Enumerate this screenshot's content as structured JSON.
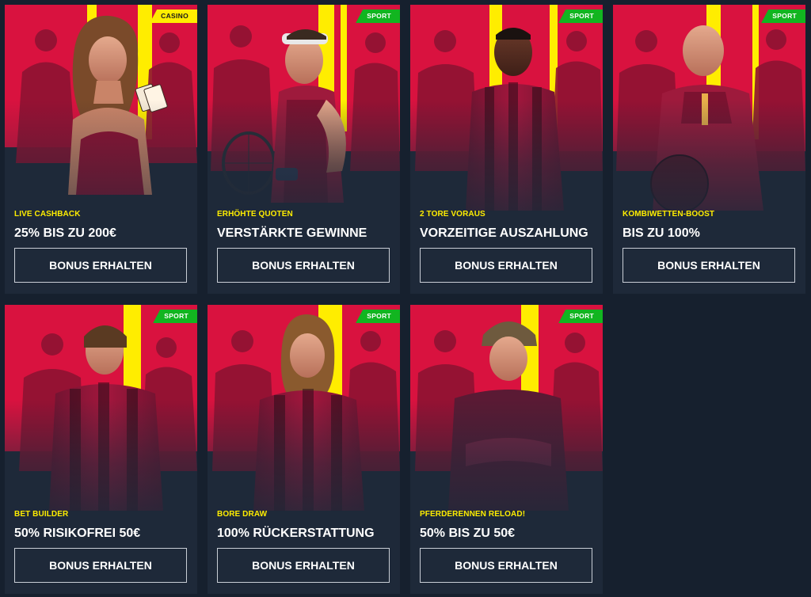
{
  "colors": {
    "page_background": "#16202e",
    "card_background": "#1e2939",
    "art_red": "#d9123f",
    "art_yellow": "#ffed00",
    "eyebrow_yellow": "#ffed00",
    "casino_badge": "#ffed00",
    "sport_badge": "#12b520",
    "button_border": "#c9ced6"
  },
  "promotions": [
    {
      "badge": "CASINO",
      "badge_kind": "casino",
      "eyebrow": "LIVE CASHBACK",
      "title": "25% BIS ZU 200€",
      "button_label": "BONUS ERHALTEN",
      "art": "casino-dealer-woman-with-playing-cards"
    },
    {
      "badge": "SPORT",
      "badge_kind": "sport",
      "eyebrow": "ERHÖHTE QUOTEN",
      "title": "VERSTÄRKTE GEWINNE",
      "button_label": "BONUS ERHALTEN",
      "art": "tennis-player-with-headband-and-racket"
    },
    {
      "badge": "SPORT",
      "badge_kind": "sport",
      "eyebrow": "2 TORE VORAUS",
      "title": "VORZEITIGE AUSZAHLUNG",
      "button_label": "BONUS ERHALTEN",
      "art": "footballer-in-striped-jersey"
    },
    {
      "badge": "SPORT",
      "badge_kind": "sport",
      "eyebrow": "KOMBIWETTEN-BOOST",
      "title": "BIS ZU 100%",
      "button_label": "BONUS ERHALTEN",
      "art": "bald-footballer-holding-ball"
    },
    {
      "badge": "SPORT",
      "badge_kind": "sport",
      "eyebrow": "BET BUILDER",
      "title": "50% RISIKOFREI 50€",
      "button_label": "BONUS ERHALTEN",
      "art": "footballer-in-striped-jersey"
    },
    {
      "badge": "SPORT",
      "badge_kind": "sport",
      "eyebrow": "BORE DRAW",
      "title": "100% RÜCKERSTATTUNG",
      "button_label": "BONUS ERHALTEN",
      "art": "long-haired-footballer-in-striped-jersey"
    },
    {
      "badge": "SPORT",
      "badge_kind": "sport",
      "eyebrow": "PFERDERENNEN RELOAD!",
      "title": "50% BIS ZU 50€",
      "button_label": "BONUS ERHALTEN",
      "art": "jockey-with-helmet-arms-crossed"
    }
  ]
}
